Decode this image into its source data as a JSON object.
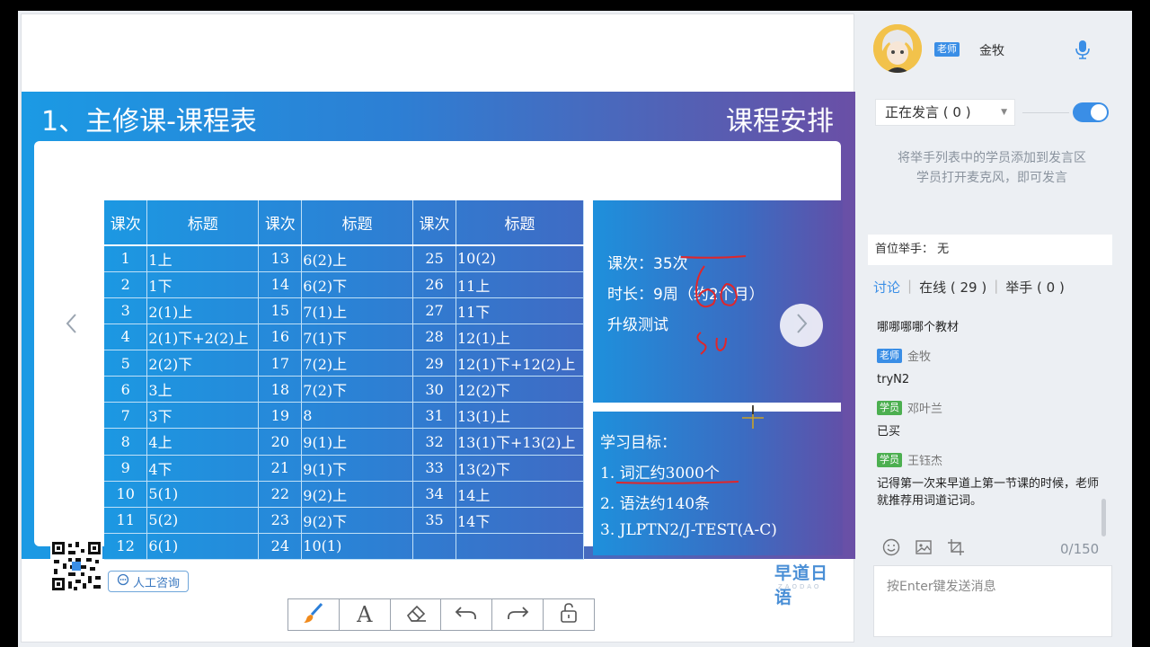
{
  "slide": {
    "title": "1、主修课-课程表",
    "right_title": "课程安排",
    "table_headers": [
      "课次",
      "标题",
      "课次",
      "标题",
      "课次",
      "标题"
    ],
    "rows": [
      [
        "1",
        "1上",
        "13",
        "6(2)上",
        "25",
        "10(2)"
      ],
      [
        "2",
        "1下",
        "14",
        "6(2)下",
        "26",
        "11上"
      ],
      [
        "3",
        "2(1)上",
        "15",
        "7(1)上",
        "27",
        "11下"
      ],
      [
        "4",
        "2(1)下+2(2)上",
        "16",
        "7(1)下",
        "28",
        "12(1)上"
      ],
      [
        "5",
        "2(2)下",
        "17",
        "7(2)上",
        "29",
        "12(1)下+12(2)上"
      ],
      [
        "6",
        "3上",
        "18",
        "7(2)下",
        "30",
        "12(2)下"
      ],
      [
        "7",
        "3下",
        "19",
        "8",
        "31",
        "13(1)上"
      ],
      [
        "8",
        "4上",
        "20",
        "9(1)上",
        "32",
        "13(1)下+13(2)上"
      ],
      [
        "9",
        "4下",
        "21",
        "9(1)下",
        "33",
        "13(2)下"
      ],
      [
        "10",
        "5(1)",
        "22",
        "9(2)上",
        "34",
        "14上"
      ],
      [
        "11",
        "5(2)",
        "23",
        "9(2)下",
        "35",
        "14下"
      ],
      [
        "12",
        "6(1)",
        "24",
        "10(1)",
        "",
        ""
      ]
    ],
    "info": {
      "sessions": "课次：35次",
      "duration": "时长：9周（约2个月）",
      "test": "升级测试"
    },
    "goals": {
      "heading": "学习目标：",
      "items": [
        "1.  词汇约3000个",
        "2.  语法约140条",
        "3.  JLPTN2/J-TEST(A-C)"
      ]
    },
    "consult_label": "人工咨询",
    "brand": "早道日语",
    "brand_sub": "ZAODAO"
  },
  "sidebar": {
    "teacher_badge": "老师",
    "teacher_name": "金牧",
    "speaking_select": "正在发言 ( 0 )",
    "hint_line1": "将举手列表中的学员添加到发言区",
    "hint_line2": "学员打开麦克风，即可发言",
    "first_hand": "首位举手：  无",
    "tabs": {
      "discuss": "讨论",
      "online": "在线 ( 29 )",
      "raise": "举手 ( 0 )"
    },
    "messages": [
      {
        "badge": "",
        "role": "",
        "name": "",
        "text": "哪哪哪哪个教材"
      },
      {
        "badge": "老师",
        "role": "teacher",
        "name": "金牧",
        "text": "tryN2"
      },
      {
        "badge": "学员",
        "role": "student",
        "name": "邓叶兰",
        "text": "已买"
      },
      {
        "badge": "学员",
        "role": "student",
        "name": "王钰杰",
        "text": "记得第一次来早道上第一节课的时候，老师就推荐用词道记词。"
      }
    ],
    "counter": "0/150",
    "input_placeholder": "按Enter键发送消息"
  },
  "toolbar": {
    "icons": [
      "brush-icon",
      "text-icon",
      "eraser-icon",
      "undo-icon",
      "redo-icon",
      "unlock-icon"
    ]
  },
  "colors": {
    "accent": "#3a8ee6",
    "slide_start": "#1b9ae4",
    "slide_end": "#6a4fa6",
    "ink_red": "#e0262a"
  }
}
